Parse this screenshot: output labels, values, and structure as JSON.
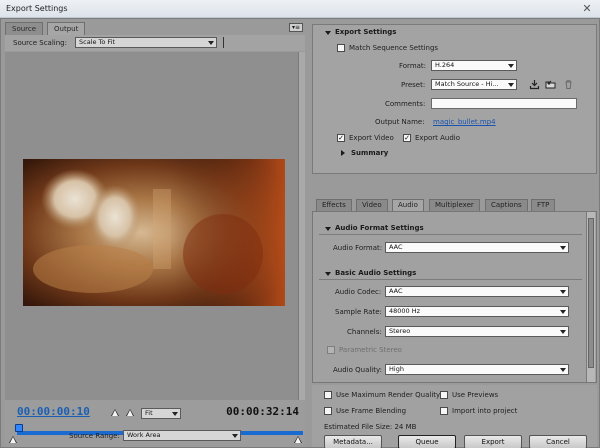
{
  "window": {
    "title": "Export Settings",
    "close_glyph": "✕"
  },
  "left": {
    "tabs": [
      {
        "label": "Source",
        "active": false
      },
      {
        "label": "Output",
        "active": true
      }
    ],
    "panel_menu_glyph": "▾≡",
    "source_scaling": {
      "label": "Source Scaling:",
      "value": "Scale To Fit"
    },
    "timecode_current": "00:00:00:10",
    "timecode_duration": "00:00:32:14",
    "fit_zoom": "Fit",
    "source_range": {
      "label": "Source Range:",
      "value": "Work Area"
    }
  },
  "export_settings": {
    "header": "Export Settings",
    "match_sequence": {
      "label": "Match Sequence Settings",
      "checked": false
    },
    "format": {
      "label": "Format:",
      "value": "H.264"
    },
    "preset": {
      "label": "Preset:",
      "value": "Match Source - Hi..."
    },
    "comments": {
      "label": "Comments:",
      "value": ""
    },
    "output_name": {
      "label": "Output Name:",
      "value": "magic_bullet.mp4"
    },
    "export_video": {
      "label": "Export Video",
      "checked": true
    },
    "export_audio": {
      "label": "Export Audio",
      "checked": true
    },
    "summary": "Summary"
  },
  "subtabs": [
    {
      "label": "Effects",
      "active": false
    },
    {
      "label": "Video",
      "active": false
    },
    {
      "label": "Audio",
      "active": true
    },
    {
      "label": "Multiplexer",
      "active": false
    },
    {
      "label": "Captions",
      "active": false
    },
    {
      "label": "FTP",
      "active": false
    }
  ],
  "audio": {
    "format_header": "Audio Format Settings",
    "audio_format": {
      "label": "Audio Format:",
      "value": "AAC"
    },
    "basic_header": "Basic Audio Settings",
    "audio_codec": {
      "label": "Audio Codec:",
      "value": "AAC"
    },
    "sample_rate": {
      "label": "Sample Rate:",
      "value": "48000 Hz"
    },
    "channels": {
      "label": "Channels:",
      "value": "Stereo"
    },
    "parametric_stereo": {
      "label": "Parametric Stereo",
      "enabled": false
    },
    "audio_quality": {
      "label": "Audio Quality:",
      "value": "High"
    }
  },
  "bottom": {
    "max_render_quality": {
      "label": "Use Maximum Render Quality",
      "checked": false
    },
    "use_previews": {
      "label": "Use Previews",
      "checked": false
    },
    "frame_blending": {
      "label": "Use Frame Blending",
      "checked": false
    },
    "import_into_project": {
      "label": "Import into project",
      "checked": false
    },
    "file_size": "Estimated File Size:  24 MB",
    "buttons": {
      "metadata": "Metadata...",
      "queue": "Queue",
      "export": "Export",
      "cancel": "Cancel"
    }
  },
  "colors": {
    "accent": "#1a6bd1",
    "timecode": "#1a5fb3",
    "link": "#1a53b0"
  }
}
